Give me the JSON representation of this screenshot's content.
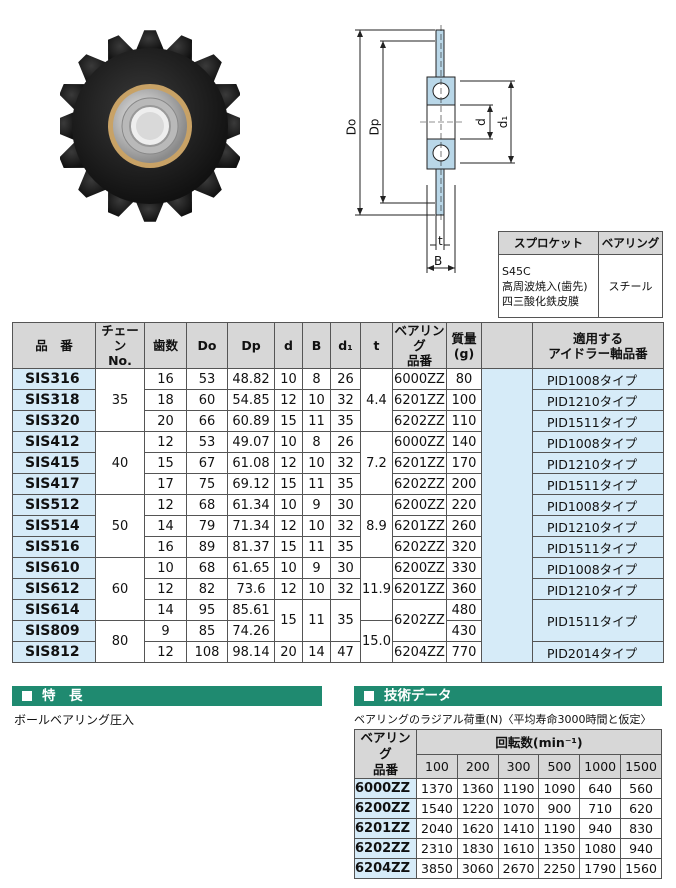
{
  "diagram": {
    "label_Do": "Do",
    "label_Dp": "Dp",
    "label_d": "d",
    "label_d1": "d₁",
    "label_t": "t",
    "label_B": "B"
  },
  "material": {
    "headers": [
      "スプロケット",
      "ベアリング"
    ],
    "sprocket_lines": [
      "S45C",
      "高周波焼入(歯先)",
      "四三酸化鉄皮膜"
    ],
    "bearing": "スチール"
  },
  "main": {
    "headers": {
      "part": "品　番",
      "chain": [
        "チェーン",
        "No."
      ],
      "teeth": "歯数",
      "Do": "Do",
      "Dp": "Dp",
      "d": "d",
      "B": "B",
      "d1": "d₁",
      "t": "t",
      "bearing": [
        "ベアリング",
        "品番"
      ],
      "mass": [
        "質量",
        "(g)"
      ],
      "app": [
        "適用する",
        "アイドラー軸品番"
      ]
    },
    "rows": [
      {
        "part": "SIS316",
        "teeth": "16",
        "Do": "53",
        "Dp": "48.82",
        "d": "10",
        "B": "8",
        "d1": "26",
        "bearing": "6000ZZ",
        "mass": "80",
        "app": "PID1008タイプ"
      },
      {
        "part": "SIS318",
        "teeth": "18",
        "Do": "60",
        "Dp": "54.85",
        "d": "12",
        "B": "10",
        "d1": "32",
        "bearing": "6201ZZ",
        "mass": "100",
        "app": "PID1210タイプ"
      },
      {
        "part": "SIS320",
        "teeth": "20",
        "Do": "66",
        "Dp": "60.89",
        "d": "15",
        "B": "11",
        "d1": "35",
        "bearing": "6202ZZ",
        "mass": "110",
        "app": "PID1511タイプ"
      },
      {
        "part": "SIS412",
        "teeth": "12",
        "Do": "53",
        "Dp": "49.07",
        "d": "10",
        "B": "8",
        "d1": "26",
        "bearing": "6000ZZ",
        "mass": "140",
        "app": "PID1008タイプ"
      },
      {
        "part": "SIS415",
        "teeth": "15",
        "Do": "67",
        "Dp": "61.08",
        "d": "12",
        "B": "10",
        "d1": "32",
        "bearing": "6201ZZ",
        "mass": "170",
        "app": "PID1210タイプ"
      },
      {
        "part": "SIS417",
        "teeth": "17",
        "Do": "75",
        "Dp": "69.12",
        "d": "15",
        "B": "11",
        "d1": "35",
        "bearing": "6202ZZ",
        "mass": "200",
        "app": "PID1511タイプ"
      },
      {
        "part": "SIS512",
        "teeth": "12",
        "Do": "68",
        "Dp": "61.34",
        "d": "10",
        "B": "9",
        "d1": "30",
        "bearing": "6200ZZ",
        "mass": "220",
        "app": "PID1008タイプ"
      },
      {
        "part": "SIS514",
        "teeth": "14",
        "Do": "79",
        "Dp": "71.34",
        "d": "12",
        "B": "10",
        "d1": "32",
        "bearing": "6201ZZ",
        "mass": "260",
        "app": "PID1210タイプ"
      },
      {
        "part": "SIS516",
        "teeth": "16",
        "Do": "89",
        "Dp": "81.37",
        "d": "15",
        "B": "11",
        "d1": "35",
        "bearing": "6202ZZ",
        "mass": "320",
        "app": "PID1511タイプ"
      },
      {
        "part": "SIS610",
        "teeth": "10",
        "Do": "68",
        "Dp": "61.65",
        "d": "10",
        "B": "9",
        "d1": "30",
        "bearing": "6200ZZ",
        "mass": "330",
        "app": "PID1008タイプ"
      },
      {
        "part": "SIS612",
        "teeth": "12",
        "Do": "82",
        "Dp": "73.6",
        "d": "12",
        "B": "10",
        "d1": "32",
        "bearing": "6201ZZ",
        "mass": "360",
        "app": "PID1210タイプ"
      },
      {
        "part": "SIS614",
        "teeth": "14",
        "Do": "95",
        "Dp": "85.61",
        "mass": "480"
      },
      {
        "part": "SIS809",
        "teeth": "9",
        "Do": "85",
        "Dp": "74.26",
        "mass": "430"
      },
      {
        "part": "SIS812",
        "teeth": "12",
        "Do": "108",
        "Dp": "98.14",
        "d": "20",
        "B": "14",
        "d1": "47",
        "bearing": "6204ZZ",
        "mass": "770",
        "app": "PID2014タイプ"
      }
    ],
    "chain_groups": [
      "35",
      "40",
      "50",
      "60",
      "80"
    ],
    "t_groups": [
      "4.4",
      "7.2",
      "8.9",
      "11.9",
      "15.0"
    ],
    "merged_614_809": {
      "d": "15",
      "B": "11",
      "d1": "35",
      "bearing": "6202ZZ",
      "app": "PID1511タイプ"
    }
  },
  "features": {
    "title": "特　長",
    "text": "ボールベアリング圧入"
  },
  "tech": {
    "title": "技術データ",
    "subtitle": "ベアリングのラジアル荷重(N)〈平均寿命3000時間と仮定〉",
    "header_part": [
      "ベアリング",
      "品番"
    ],
    "header_rpm": "回転数(min⁻¹)",
    "rpm": [
      "100",
      "200",
      "300",
      "500",
      "1000",
      "1500"
    ],
    "rows": [
      {
        "part": "6000ZZ",
        "vals": [
          "1370",
          "1360",
          "1190",
          "1090",
          "640",
          "560"
        ]
      },
      {
        "part": "6200ZZ",
        "vals": [
          "1540",
          "1220",
          "1070",
          "900",
          "710",
          "620"
        ]
      },
      {
        "part": "6201ZZ",
        "vals": [
          "2040",
          "1620",
          "1410",
          "1190",
          "940",
          "830"
        ]
      },
      {
        "part": "6202ZZ",
        "vals": [
          "2310",
          "1830",
          "1610",
          "1350",
          "1080",
          "940"
        ]
      },
      {
        "part": "6204ZZ",
        "vals": [
          "3850",
          "3060",
          "2670",
          "2250",
          "1790",
          "1560"
        ]
      }
    ]
  }
}
